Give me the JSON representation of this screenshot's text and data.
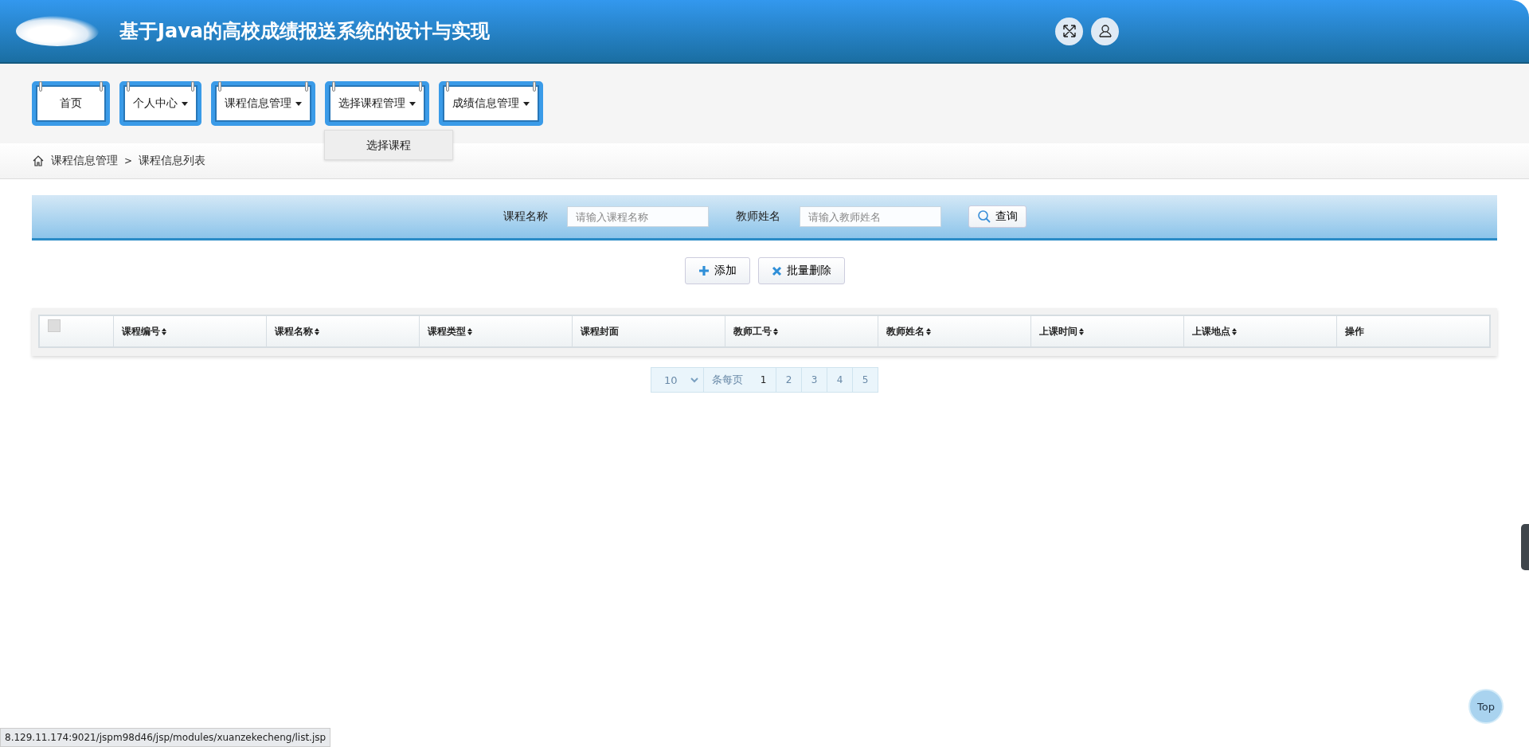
{
  "header": {
    "title": "基于Java的高校成绩报送系统的设计与实现"
  },
  "nav": [
    {
      "label": "首页",
      "has_menu": false
    },
    {
      "label": "个人中心",
      "has_menu": true
    },
    {
      "label": "课程信息管理",
      "has_menu": true
    },
    {
      "label": "选择课程管理",
      "has_menu": true,
      "open_menu": [
        "选择课程"
      ]
    },
    {
      "label": "成绩信息管理",
      "has_menu": true
    }
  ],
  "breadcrumb": [
    "课程信息管理",
    "课程信息列表"
  ],
  "breadcrumb_separator": ">",
  "search": {
    "fields": [
      {
        "label": "课程名称",
        "placeholder": "请输入课程名称"
      },
      {
        "label": "教师姓名",
        "placeholder": "请输入教师姓名"
      }
    ],
    "button": "查询"
  },
  "actions": [
    {
      "kind": "add",
      "label": "添加"
    },
    {
      "kind": "delete",
      "label": "批量删除"
    }
  ],
  "table": {
    "select_all": {
      "checked": false
    },
    "columns": [
      {
        "label": "课程编号",
        "sortable": true
      },
      {
        "label": "课程名称",
        "sortable": true
      },
      {
        "label": "课程类型",
        "sortable": true
      },
      {
        "label": "课程封面",
        "sortable": false
      },
      {
        "label": "教师工号",
        "sortable": true
      },
      {
        "label": "教师姓名",
        "sortable": true
      },
      {
        "label": "上课时间",
        "sortable": true
      },
      {
        "label": "上课地点",
        "sortable": true
      },
      {
        "label": "操作",
        "sortable": false
      }
    ]
  },
  "pagination": {
    "page_size": "10",
    "per_page_label": "条每页",
    "pages": [
      {
        "label": "1",
        "selected": true
      },
      {
        "label": "2",
        "selected": false
      },
      {
        "label": "3",
        "selected": false
      },
      {
        "label": "4",
        "selected": false
      },
      {
        "label": "5",
        "selected": false
      }
    ]
  },
  "top_button": "Top",
  "status_url": "8.129.11.174:9021/jspm98d46/jsp/modules/xuanzekecheng/list.jsp"
}
